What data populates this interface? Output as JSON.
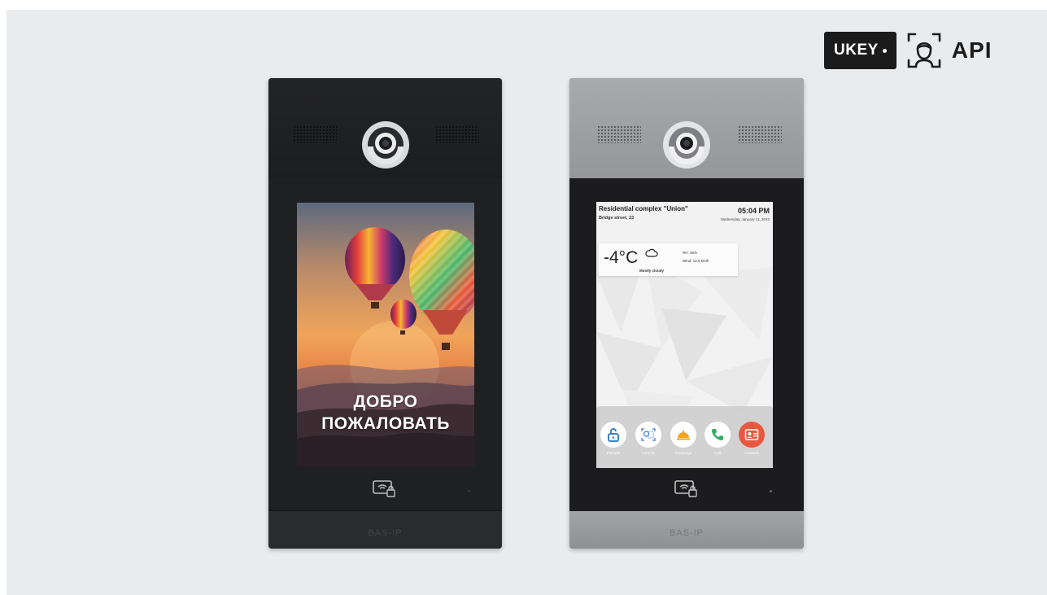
{
  "logo": {
    "brand": "UKEY",
    "suffix": "API",
    "icon": "face-recognition-icon"
  },
  "dark_panel": {
    "welcome_line1": "ДОБРО",
    "welcome_line2": "ПОЖАЛОВАТЬ",
    "brand": "BAS-IP"
  },
  "silver_panel": {
    "brand": "BAS-IP",
    "header": {
      "title": "Residential complex \"Union\"",
      "address": "Bridge street, 23",
      "time": "05:04 PM",
      "date": "Wednesday, January 11, 2023"
    },
    "weather": {
      "temperature": "-4°C",
      "description": "Mostly cloudy",
      "humidity": "RH: 46%",
      "wind": "Wind: 12.6 km/h",
      "icon": "cloud-icon"
    },
    "dock": [
      {
        "label": "Pincode",
        "icon": "lock-icon",
        "color": "#3b82c4"
      },
      {
        "label": "Face ID",
        "icon": "face-id-icon",
        "color": "#5b8ed6"
      },
      {
        "label": "Concierge",
        "icon": "concierge-bell-icon",
        "color": "#f5a623"
      },
      {
        "label": "Call",
        "icon": "phone-icon",
        "color": "#2eaf5e"
      },
      {
        "label": "Contacts",
        "icon": "contacts-icon",
        "color": "#e8583f"
      }
    ]
  },
  "colors": {
    "background": "#eaebed",
    "dark_panel": "#1f2022",
    "silver_panel": "#9c9da0"
  }
}
